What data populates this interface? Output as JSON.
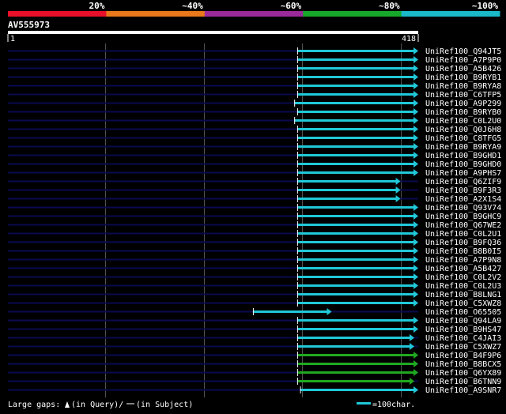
{
  "colors": {
    "scale": [
      "#e8102a",
      "#e8781a",
      "#9a2a9a",
      "#16a82a",
      "#1ab8c8"
    ],
    "hit_cyan": "#20c8d8",
    "hit_green": "#20a820",
    "track": "#0a0a50",
    "grid": "#505050",
    "label": "#ffffff"
  },
  "header": {
    "scale_labels": [
      "20%",
      "~40%",
      "~60%",
      "~80%",
      "~100%"
    ]
  },
  "query": {
    "name": "AV555973",
    "start_label": "1",
    "end_label": "418",
    "length": 418
  },
  "hits": [
    {
      "id": "UniRef100_Q94JT5",
      "start": 295,
      "end": 418,
      "color": "cyan"
    },
    {
      "id": "UniRef100_A7P9P0",
      "start": 295,
      "end": 418,
      "color": "cyan"
    },
    {
      "id": "UniRef100_A5B426",
      "start": 295,
      "end": 418,
      "color": "cyan"
    },
    {
      "id": "UniRef100_B9RYB1",
      "start": 295,
      "end": 418,
      "color": "cyan"
    },
    {
      "id": "UniRef100_B9RYA8",
      "start": 295,
      "end": 418,
      "color": "cyan"
    },
    {
      "id": "UniRef100_C6TFP5",
      "start": 295,
      "end": 418,
      "color": "cyan"
    },
    {
      "id": "UniRef100_A9P299",
      "start": 292,
      "end": 418,
      "color": "cyan"
    },
    {
      "id": "UniRef100_B9RYB0",
      "start": 295,
      "end": 418,
      "color": "cyan"
    },
    {
      "id": "UniRef100_C0L2U0",
      "start": 292,
      "end": 418,
      "color": "cyan"
    },
    {
      "id": "UniRef100_Q0J6H8",
      "start": 295,
      "end": 418,
      "color": "cyan"
    },
    {
      "id": "UniRef100_C8TFG5",
      "start": 295,
      "end": 418,
      "color": "cyan"
    },
    {
      "id": "UniRef100_B9RYA9",
      "start": 295,
      "end": 418,
      "color": "cyan"
    },
    {
      "id": "UniRef100_B9GHD1",
      "start": 295,
      "end": 418,
      "color": "cyan"
    },
    {
      "id": "UniRef100_B9GHD0",
      "start": 295,
      "end": 418,
      "color": "cyan"
    },
    {
      "id": "UniRef100_A9PHS7",
      "start": 295,
      "end": 418,
      "color": "cyan"
    },
    {
      "id": "UniRef100_Q6ZIF9",
      "start": 295,
      "end": 400,
      "color": "cyan"
    },
    {
      "id": "UniRef100_B9F3R3",
      "start": 295,
      "end": 400,
      "color": "cyan"
    },
    {
      "id": "UniRef100_A2X1S4",
      "start": 295,
      "end": 400,
      "color": "cyan"
    },
    {
      "id": "UniRef100_Q93V74",
      "start": 295,
      "end": 418,
      "color": "cyan"
    },
    {
      "id": "UniRef100_B9GHC9",
      "start": 295,
      "end": 418,
      "color": "cyan"
    },
    {
      "id": "UniRef100_Q67WE2",
      "start": 295,
      "end": 418,
      "color": "cyan"
    },
    {
      "id": "UniRef100_C0L2U1",
      "start": 295,
      "end": 418,
      "color": "cyan"
    },
    {
      "id": "UniRef100_B9FQ36",
      "start": 295,
      "end": 418,
      "color": "cyan"
    },
    {
      "id": "UniRef100_B8B0I5",
      "start": 295,
      "end": 418,
      "color": "cyan"
    },
    {
      "id": "UniRef100_A7P9N8",
      "start": 295,
      "end": 418,
      "color": "cyan"
    },
    {
      "id": "UniRef100_A5B427",
      "start": 295,
      "end": 418,
      "color": "cyan"
    },
    {
      "id": "UniRef100_C0L2V2",
      "start": 295,
      "end": 418,
      "color": "cyan"
    },
    {
      "id": "UniRef100_C0L2U3",
      "start": 295,
      "end": 418,
      "color": "cyan"
    },
    {
      "id": "UniRef100_B8LNG1",
      "start": 295,
      "end": 418,
      "color": "cyan"
    },
    {
      "id": "UniRef100_C5XWZ8",
      "start": 295,
      "end": 418,
      "color": "cyan"
    },
    {
      "id": "UniRef100_O65505",
      "start": 250,
      "end": 330,
      "color": "cyan"
    },
    {
      "id": "UniRef100_Q94LA9",
      "start": 295,
      "end": 418,
      "color": "cyan"
    },
    {
      "id": "UniRef100_B9HS47",
      "start": 295,
      "end": 418,
      "color": "cyan"
    },
    {
      "id": "UniRef100_C4JAI3",
      "start": 295,
      "end": 414,
      "color": "cyan"
    },
    {
      "id": "UniRef100_C5XWZ7",
      "start": 295,
      "end": 414,
      "color": "cyan"
    },
    {
      "id": "UniRef100_B4F9P6",
      "start": 295,
      "end": 418,
      "color": "green"
    },
    {
      "id": "UniRef100_B8BCX5",
      "start": 295,
      "end": 418,
      "color": "green"
    },
    {
      "id": "UniRef100_Q6YX89",
      "start": 295,
      "end": 418,
      "color": "green"
    },
    {
      "id": "UniRef100_B6TNN9",
      "start": 295,
      "end": 414,
      "color": "green"
    },
    {
      "id": "UniRef100_A9SNR7",
      "start": 298,
      "end": 418,
      "color": "cyan"
    }
  ],
  "footer": {
    "gaps_label": "Large gaps:",
    "query_gap": "(in Query)/",
    "subject_gap": "(in Subject)",
    "scale_label": "=100char."
  }
}
